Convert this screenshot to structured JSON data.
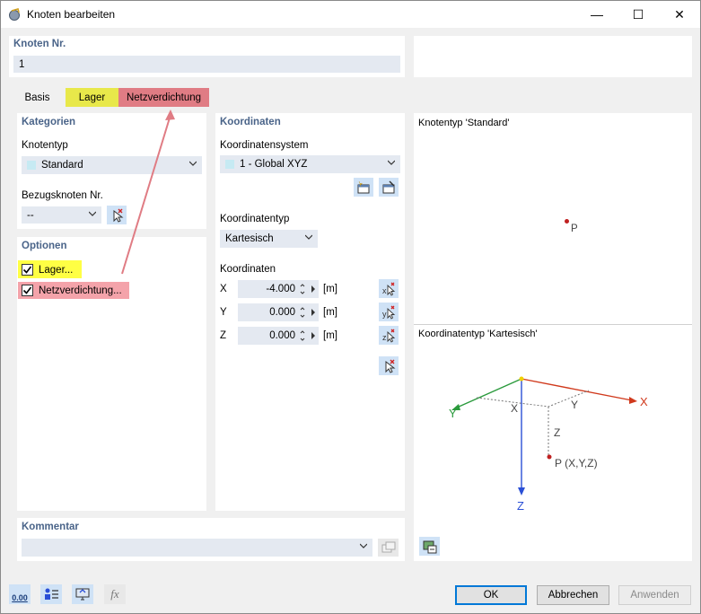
{
  "window": {
    "title": "Knoten bearbeiten",
    "minimize": "—",
    "maximize": "☐",
    "close": "✕"
  },
  "node_no": {
    "label": "Knoten Nr.",
    "value": "1"
  },
  "tabs": [
    {
      "label": "Basis"
    },
    {
      "label": "Lager"
    },
    {
      "label": "Netzverdichtung"
    }
  ],
  "kategorien": {
    "title": "Kategorien",
    "knotentyp_label": "Knotentyp",
    "knotentyp_value": "Standard",
    "bezug_label": "Bezugsknoten Nr.",
    "bezug_value": "--"
  },
  "optionen": {
    "title": "Optionen",
    "lager": "Lager...",
    "netz": "Netzverdichtung..."
  },
  "koordinaten": {
    "title": "Koordinaten",
    "system_label": "Koordinatensystem",
    "system_value": "1 - Global XYZ",
    "typ_label": "Koordinatentyp",
    "typ_value": "Kartesisch",
    "coords_label": "Koordinaten",
    "rows": [
      {
        "axis": "X",
        "value": "-4.000",
        "unit": "[m]"
      },
      {
        "axis": "Y",
        "value": "0.000",
        "unit": "[m]"
      },
      {
        "axis": "Z",
        "value": "0.000",
        "unit": "[m]"
      }
    ]
  },
  "preview": {
    "knotentyp_caption": "Knotentyp 'Standard'",
    "point_label": "P",
    "koordtyp_caption": "Koordinatentyp 'Kartesisch'",
    "axis_x": "X",
    "axis_y": "Y",
    "axis_z": "Z",
    "proj_x": "X",
    "proj_y": "Y",
    "proj_z": "Z",
    "point_xyz": "P (X,Y,Z)"
  },
  "kommentar": {
    "label": "Kommentar",
    "value": ""
  },
  "footer": {
    "ok": "OK",
    "cancel": "Abbrechen",
    "apply": "Anwenden",
    "units_icon_text": "0.00",
    "fx_text": "fx"
  },
  "colors": {
    "tab_lager": "#e8e84a",
    "tab_netz": "#e07c84",
    "highlight_lager": "#ffff44",
    "highlight_netz": "#f4a3aa",
    "section_title": "#4a6489",
    "axis_x": "#d0391c",
    "axis_y": "#2a9a3c",
    "axis_z": "#2a4fd6"
  }
}
